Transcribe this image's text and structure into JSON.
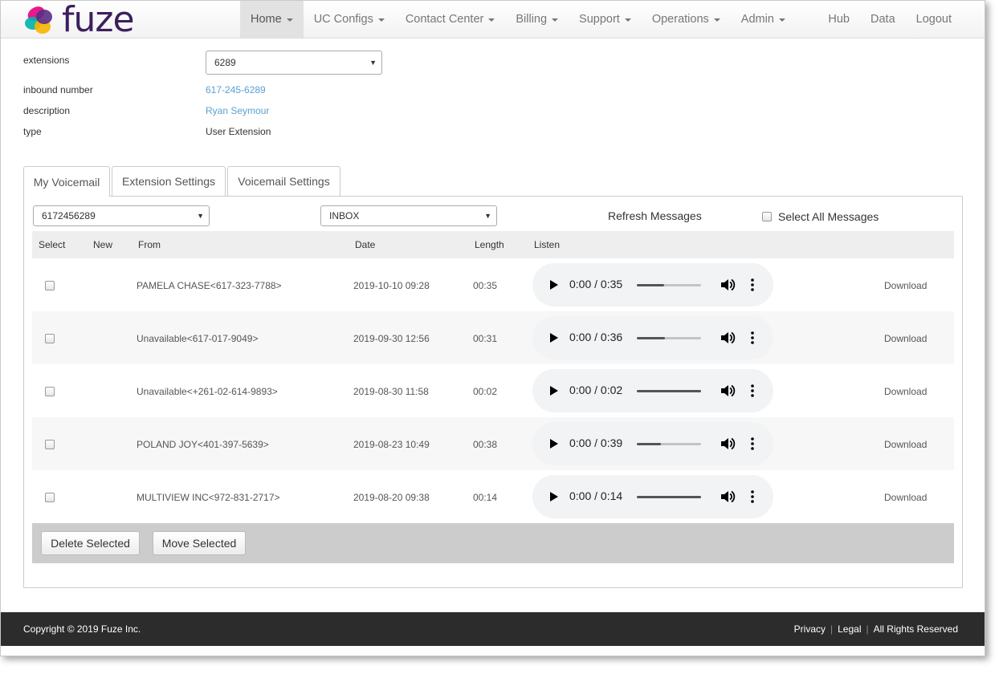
{
  "nav": {
    "logo_text": "fuze",
    "items": [
      {
        "label": "Home",
        "active": true
      },
      {
        "label": "UC Configs"
      },
      {
        "label": "Contact Center"
      },
      {
        "label": "Billing"
      },
      {
        "label": "Support"
      },
      {
        "label": "Operations"
      },
      {
        "label": "Admin"
      }
    ],
    "right": [
      "Hub",
      "Data",
      "Logout"
    ]
  },
  "info": {
    "extensions_label": "extensions",
    "extensions_value": "6289",
    "inbound_label": "inbound number",
    "inbound_value": "617-245-6289",
    "description_label": "description",
    "description_value": "Ryan Seymour",
    "type_label": "type",
    "type_value": "User Extension"
  },
  "tabs": [
    "My Voicemail",
    "Extension Settings",
    "Voicemail Settings"
  ],
  "toolbar": {
    "mailbox": "6172456289",
    "folder": "INBOX",
    "refresh": "Refresh Messages",
    "select_all": "Select All Messages"
  },
  "table": {
    "headers": {
      "select": "Select",
      "new": "New",
      "from": "From",
      "date": "Date",
      "length": "Length",
      "listen": "Listen"
    },
    "download_label": "Download",
    "rows": [
      {
        "from": "PAMELA CHASE<617-323-7788>",
        "date": "2019-10-10 09:28",
        "length": "00:35",
        "time": "0:00 / 0:35",
        "buffered": 0.42
      },
      {
        "from": "Unavailable<617-017-9049>",
        "date": "2019-09-30 12:56",
        "length": "00:31",
        "time": "0:00 / 0:36",
        "buffered": 0.44
      },
      {
        "from": "Unavailable<+261-02-614-9893>",
        "date": "2019-08-30 11:58",
        "length": "00:02",
        "time": "0:00 / 0:02",
        "buffered": 1.0
      },
      {
        "from": "POLAND JOY<401-397-5639>",
        "date": "2019-08-23 10:49",
        "length": "00:38",
        "time": "0:00 / 0:39",
        "buffered": 0.37
      },
      {
        "from": "MULTIVIEW INC<972-831-2717>",
        "date": "2019-08-20 09:38",
        "length": "00:14",
        "time": "0:00 / 0:14",
        "buffered": 1.0
      }
    ]
  },
  "actions": {
    "delete": "Delete Selected",
    "move": "Move Selected"
  },
  "footer": {
    "copyright": "Copyright © 2019 Fuze Inc.",
    "links": [
      "Privacy",
      "Legal",
      "All Rights Reserved"
    ]
  }
}
